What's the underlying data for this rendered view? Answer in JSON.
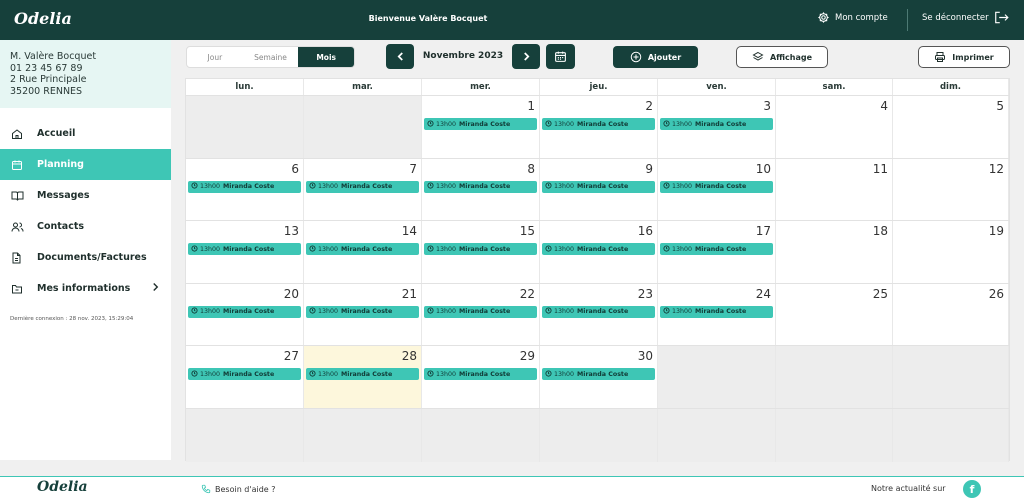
{
  "header": {
    "logo": "Odelia",
    "welcome": "Bienvenue Valère Bocquet",
    "account_label": "Mon compte",
    "logout_label": "Se déconnecter"
  },
  "user": {
    "name": "M. Valère Bocquet",
    "phone": "01 23 45 67 89",
    "address": "2 Rue Principale",
    "city": "35200 RENNES"
  },
  "nav": [
    {
      "label": "Accueil",
      "icon": "home-icon"
    },
    {
      "label": "Planning",
      "icon": "calendar-icon",
      "active": true
    },
    {
      "label": "Messages",
      "icon": "book-icon"
    },
    {
      "label": "Contacts",
      "icon": "users-icon"
    },
    {
      "label": "Documents/Factures",
      "icon": "document-icon"
    },
    {
      "label": "Mes informations",
      "icon": "folder-icon",
      "chevron": true
    }
  ],
  "last_login": "Dernière connexion : 28 nov. 2023, 15:29:04",
  "toolbar": {
    "views": [
      "Jour",
      "Semaine",
      "Mois"
    ],
    "active_view": "Mois",
    "prev_label": "‹",
    "next_label": "›",
    "month": "Novembre 2023",
    "add_label": "Ajouter",
    "display_label": "Affichage",
    "print_label": "Imprimer"
  },
  "calendar": {
    "weekdays": [
      "lun.",
      "mar.",
      "mer.",
      "jeu.",
      "ven.",
      "sam.",
      "dim."
    ],
    "weeks": [
      [
        null,
        null,
        1,
        2,
        3,
        4,
        5
      ],
      [
        6,
        7,
        8,
        9,
        10,
        11,
        12
      ],
      [
        13,
        14,
        15,
        16,
        17,
        18,
        19
      ],
      [
        20,
        21,
        22,
        23,
        24,
        25,
        26
      ],
      [
        27,
        28,
        29,
        30,
        null,
        null,
        null
      ]
    ],
    "today": 28,
    "event_days": [
      1,
      2,
      3,
      6,
      7,
      8,
      9,
      10,
      13,
      14,
      15,
      16,
      17,
      20,
      21,
      22,
      23,
      24,
      27,
      28,
      29,
      30
    ],
    "event": {
      "time": "13h00",
      "name": "Miranda Coste"
    }
  },
  "footer": {
    "logo": "Odelia",
    "help_label": "Besoin d'aide ?",
    "news_label": "Notre actualité sur",
    "facebook_label": "f"
  },
  "colors": {
    "primary_dark": "#16403b",
    "accent": "#3ec6b5",
    "today_bg": "#fdf7dc"
  }
}
